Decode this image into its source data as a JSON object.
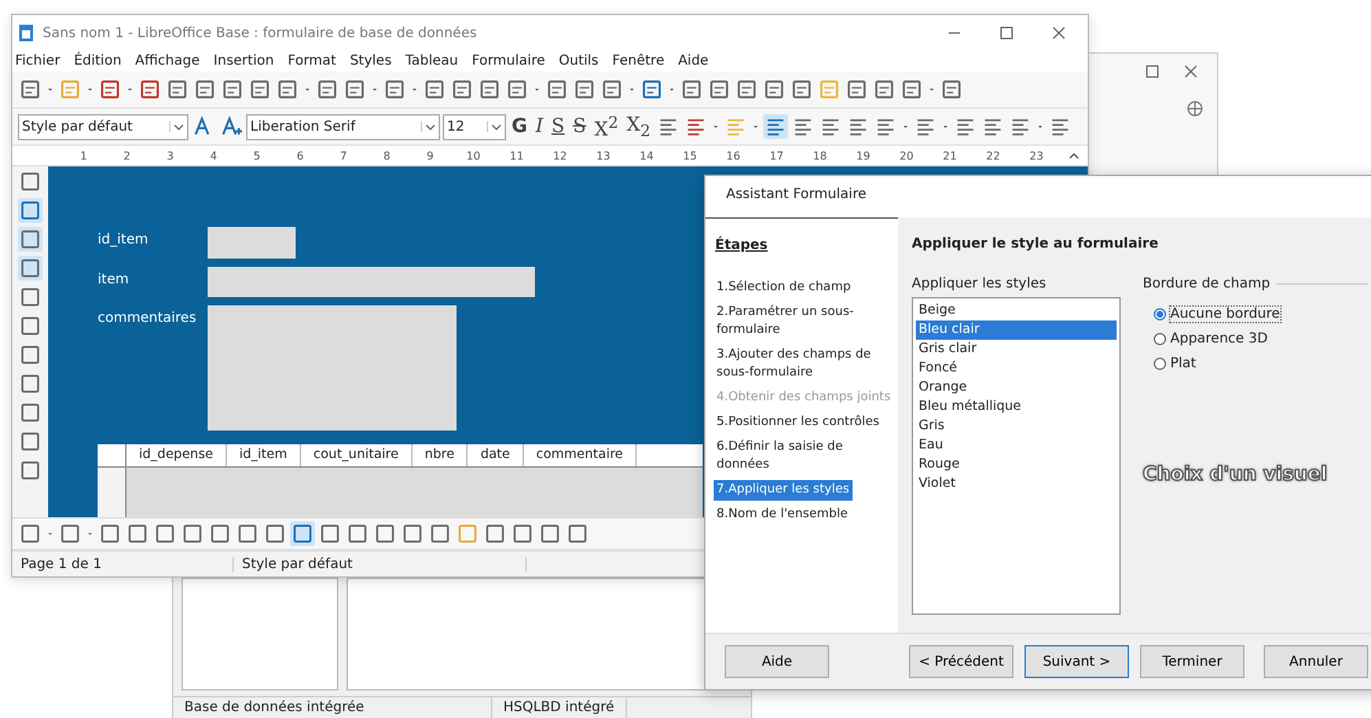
{
  "back_window": {
    "status_bar": [
      "Base de données intégrée",
      "HSQLBD intégré"
    ]
  },
  "window": {
    "title": "Sans nom 1 - LibreOffice Base : formulaire de base de données"
  },
  "menu": [
    "Fichier",
    "Édition",
    "Affichage",
    "Insertion",
    "Format",
    "Styles",
    "Tableau",
    "Formulaire",
    "Outils",
    "Fenêtre",
    "Aide"
  ],
  "format_bar": {
    "paragraph_style": "Style par défaut",
    "font_name": "Liberation Serif",
    "font_size": "12",
    "buttons": [
      {
        "label": "G",
        "kind": "bold"
      },
      {
        "label": "I",
        "kind": "italic"
      },
      {
        "label": "S",
        "kind": "underline"
      },
      {
        "label": "S",
        "kind": "strike"
      },
      {
        "label": "X$^{2}$",
        "kind": "plain"
      },
      {
        "label": "X$_{2}$",
        "kind": "plain"
      }
    ]
  },
  "ruler": [
    "1",
    "2",
    "3",
    "4",
    "5",
    "6",
    "7",
    "8",
    "9",
    "10",
    "11",
    "12",
    "13",
    "14",
    "15",
    "16",
    "17",
    "18",
    "19",
    "20",
    "21",
    "22",
    "23"
  ],
  "form": {
    "fields": [
      {
        "label": "id_item",
        "kind": "short"
      },
      {
        "label": "item",
        "kind": "long"
      },
      {
        "label": "commentaires",
        "kind": "memo"
      }
    ],
    "grid_columns": [
      "id_depense",
      "id_item",
      "cout_unitaire",
      "nbre",
      "date",
      "commentaire"
    ]
  },
  "status_bar": [
    "Page 1 de 1",
    "Style par défaut"
  ],
  "dialog": {
    "title": "Assistant Formulaire",
    "steps_heading": "Étapes",
    "steps": [
      {
        "label": "1.Sélection de champ",
        "selected": false,
        "disabled": false
      },
      {
        "label": "2.Paramétrer un sous-formulaire",
        "selected": false,
        "disabled": false
      },
      {
        "label": "3.Ajouter des champs de sous-formulaire",
        "selected": false,
        "disabled": false
      },
      {
        "label": "4.Obtenir des champs joints",
        "selected": false,
        "disabled": true
      },
      {
        "label": "5.Positionner les contrôles",
        "selected": false,
        "disabled": false
      },
      {
        "label": "6.Définir la saisie de données",
        "selected": false,
        "disabled": false
      },
      {
        "label": "7.Appliquer les styles",
        "selected": true,
        "disabled": false
      },
      {
        "label": "8.Nom de l'ensemble",
        "selected": false,
        "disabled": false
      }
    ],
    "heading": "Appliquer le style au formulaire",
    "styles_label": "Appliquer les styles",
    "styles": [
      {
        "label": "Beige",
        "selected": false
      },
      {
        "label": "Bleu clair",
        "selected": true
      },
      {
        "label": "Gris clair",
        "selected": false
      },
      {
        "label": "Foncé",
        "selected": false
      },
      {
        "label": "Orange",
        "selected": false
      },
      {
        "label": "Bleu métallique",
        "selected": false
      },
      {
        "label": "Gris",
        "selected": false
      },
      {
        "label": "Eau",
        "selected": false
      },
      {
        "label": "Rouge",
        "selected": false
      },
      {
        "label": "Violet",
        "selected": false
      }
    ],
    "border_label": "Bordure de champ",
    "borders": [
      {
        "label": "Aucune bordure",
        "selected": true
      },
      {
        "label": "Apparence 3D",
        "selected": false
      },
      {
        "label": "Plat",
        "selected": false
      }
    ],
    "buttons": [
      {
        "label": "Aide",
        "kind": "help"
      },
      {
        "label": "< Précédent",
        "kind": "nav"
      },
      {
        "label": "Suivant >",
        "kind": "default"
      },
      {
        "label": "Terminer",
        "kind": "nav"
      },
      {
        "label": "Annuler",
        "kind": "nav"
      }
    ]
  },
  "caption": "Choix d'un visuel"
}
